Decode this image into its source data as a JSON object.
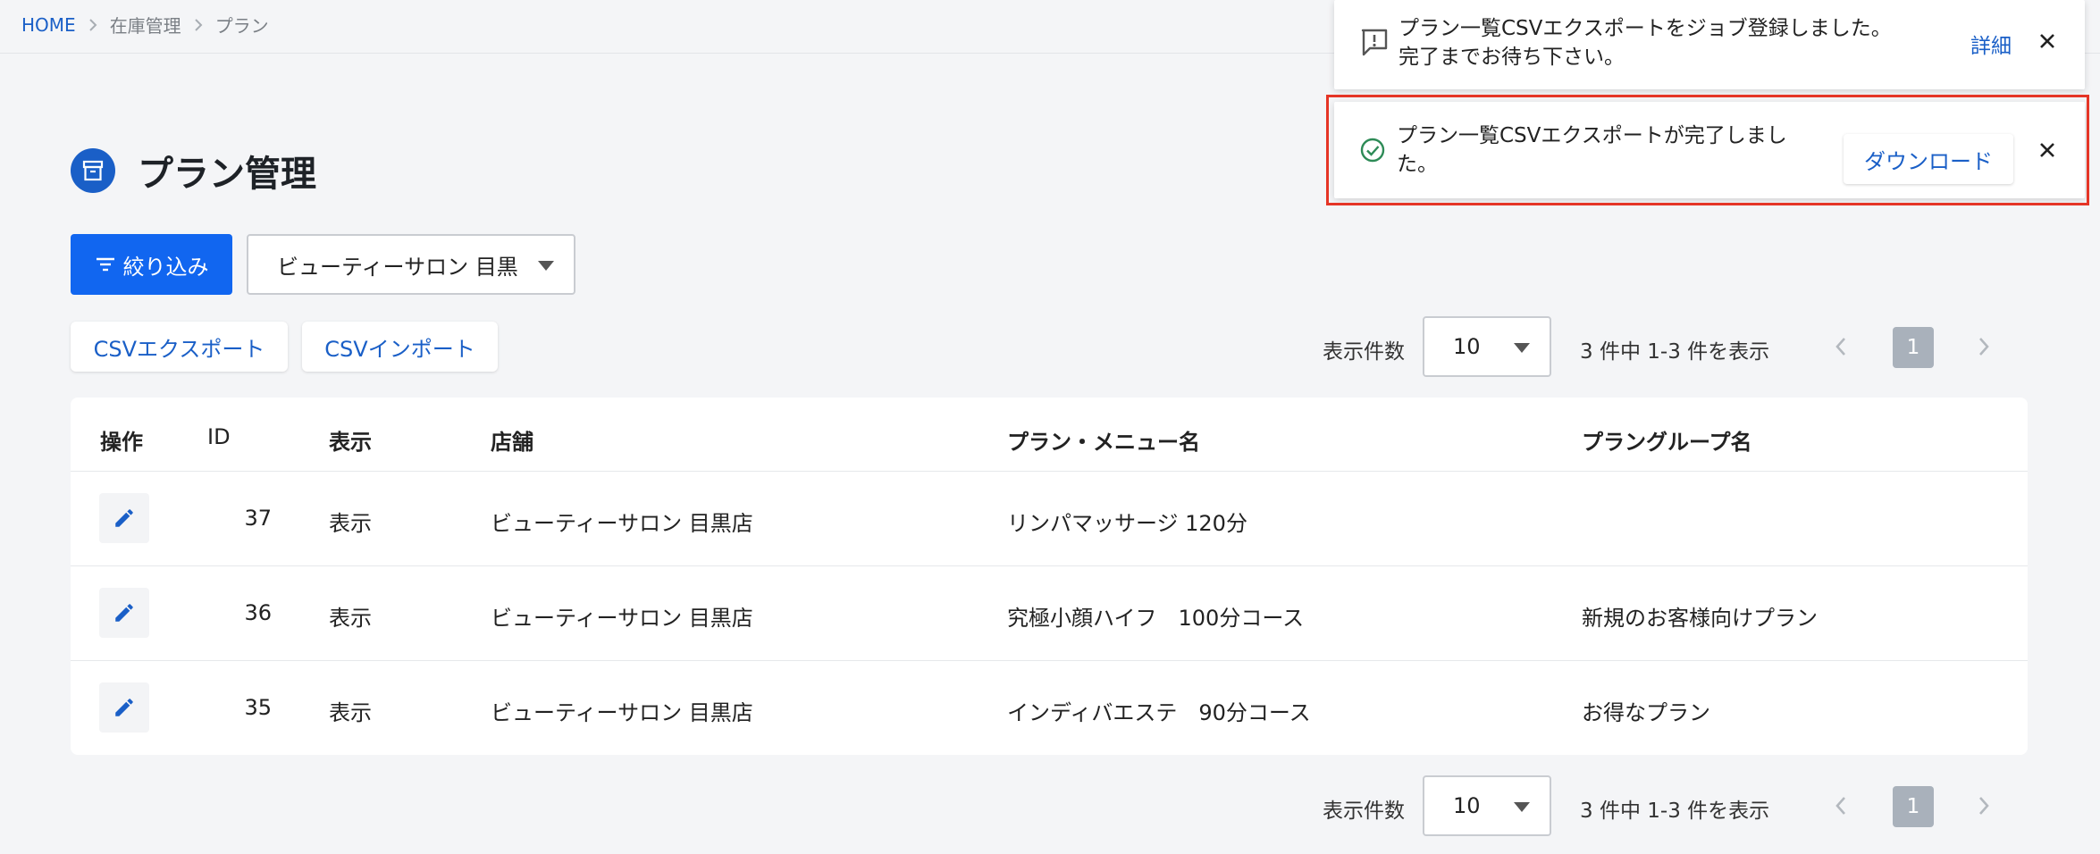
{
  "breadcrumb": {
    "home": "HOME",
    "items": [
      "在庫管理",
      "プラン"
    ]
  },
  "page": {
    "title": "プラン管理"
  },
  "filter": {
    "button_label": "絞り込み",
    "store_value": "ビューティーサロン 目黒"
  },
  "actions": {
    "csv_export": "CSVエクスポート",
    "csv_import": "CSVインポート"
  },
  "pagination": {
    "per_page_label": "表示件数",
    "per_page_value": "10",
    "count_text": "3 件中  1-3 件を表示",
    "current_page": "1"
  },
  "table": {
    "headers": [
      "操作",
      "ID",
      "表示",
      "店舗",
      "プラン・メニュー名",
      "プラングループ名"
    ],
    "rows": [
      {
        "id": "37",
        "visibility": "表示",
        "store": "ビューティーサロン 目黒店",
        "plan": "リンパマッサージ 120分",
        "group": ""
      },
      {
        "id": "36",
        "visibility": "表示",
        "store": "ビューティーサロン 目黒店",
        "plan": "究極小顔ハイフ　100分コース",
        "group": "新規のお客様向けプラン"
      },
      {
        "id": "35",
        "visibility": "表示",
        "store": "ビューティーサロン 目黒店",
        "plan": "インディバエステ　90分コース",
        "group": "お得なプラン"
      }
    ]
  },
  "toasts": {
    "job": {
      "line1": "プラン一覧CSVエクスポートをジョブ登録しました。",
      "line2": "完了までお待ち下さい。",
      "link": "詳細"
    },
    "done": {
      "line1": "プラン一覧CSVエクスポートが完了しまし",
      "line2": "た。",
      "button": "ダウンロード"
    }
  },
  "colors": {
    "primary": "#1166f0",
    "link": "#1a5fc7",
    "highlight": "#e53526",
    "success": "#2e8b57"
  }
}
